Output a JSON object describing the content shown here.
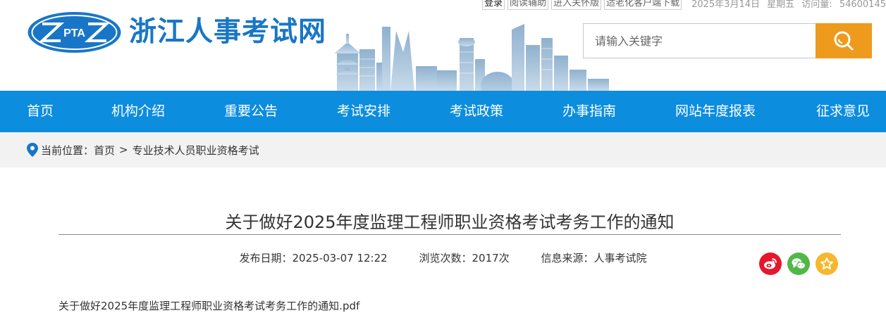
{
  "topbar": {
    "login": "登录",
    "reading_aid": "阅读辅助",
    "care_version": "进入关怀版",
    "elderly_download": "适老化客户端下载",
    "date": "2025年3月14日",
    "weekday": "星期五",
    "visits_label": "访问量:",
    "visits_count": "54600145"
  },
  "header": {
    "logo_text": "PTA",
    "site_name": "浙江人事考试网"
  },
  "search": {
    "placeholder": "请输入关键字"
  },
  "nav": {
    "items": [
      {
        "label": "首页"
      },
      {
        "label": "机构介绍"
      },
      {
        "label": "重要公告"
      },
      {
        "label": "考试安排"
      },
      {
        "label": "考试政策"
      },
      {
        "label": "办事指南"
      },
      {
        "label": "网站年度报表"
      },
      {
        "label": "征求意见"
      }
    ]
  },
  "breadcrumb": {
    "prefix": "当前位置：",
    "home": "首页",
    "separator": ">",
    "current": "专业技术人员职业资格考试"
  },
  "article": {
    "title": "关于做好2025年度监理工程师职业资格考试考务工作的通知",
    "publish_label": "发布日期：",
    "publish_date": "2025-03-07 12:22",
    "views_label": "浏览次数：",
    "views": "2017次",
    "source_label": "信息来源：",
    "source": "人事考试院",
    "attachment": "关于做好2025年度监理工程师职业资格考试考务工作的通知.pdf"
  },
  "share": {
    "icons": [
      "weibo-icon",
      "wechat-icon",
      "favorite-star-icon"
    ]
  },
  "colors": {
    "brand_blue": "#1976c6",
    "nav_blue": "#0c8dde",
    "search_orange": "#ee9b1d",
    "weibo_red": "#e6162d",
    "wechat_green": "#51b848",
    "star_yellow": "#f5b82e"
  }
}
